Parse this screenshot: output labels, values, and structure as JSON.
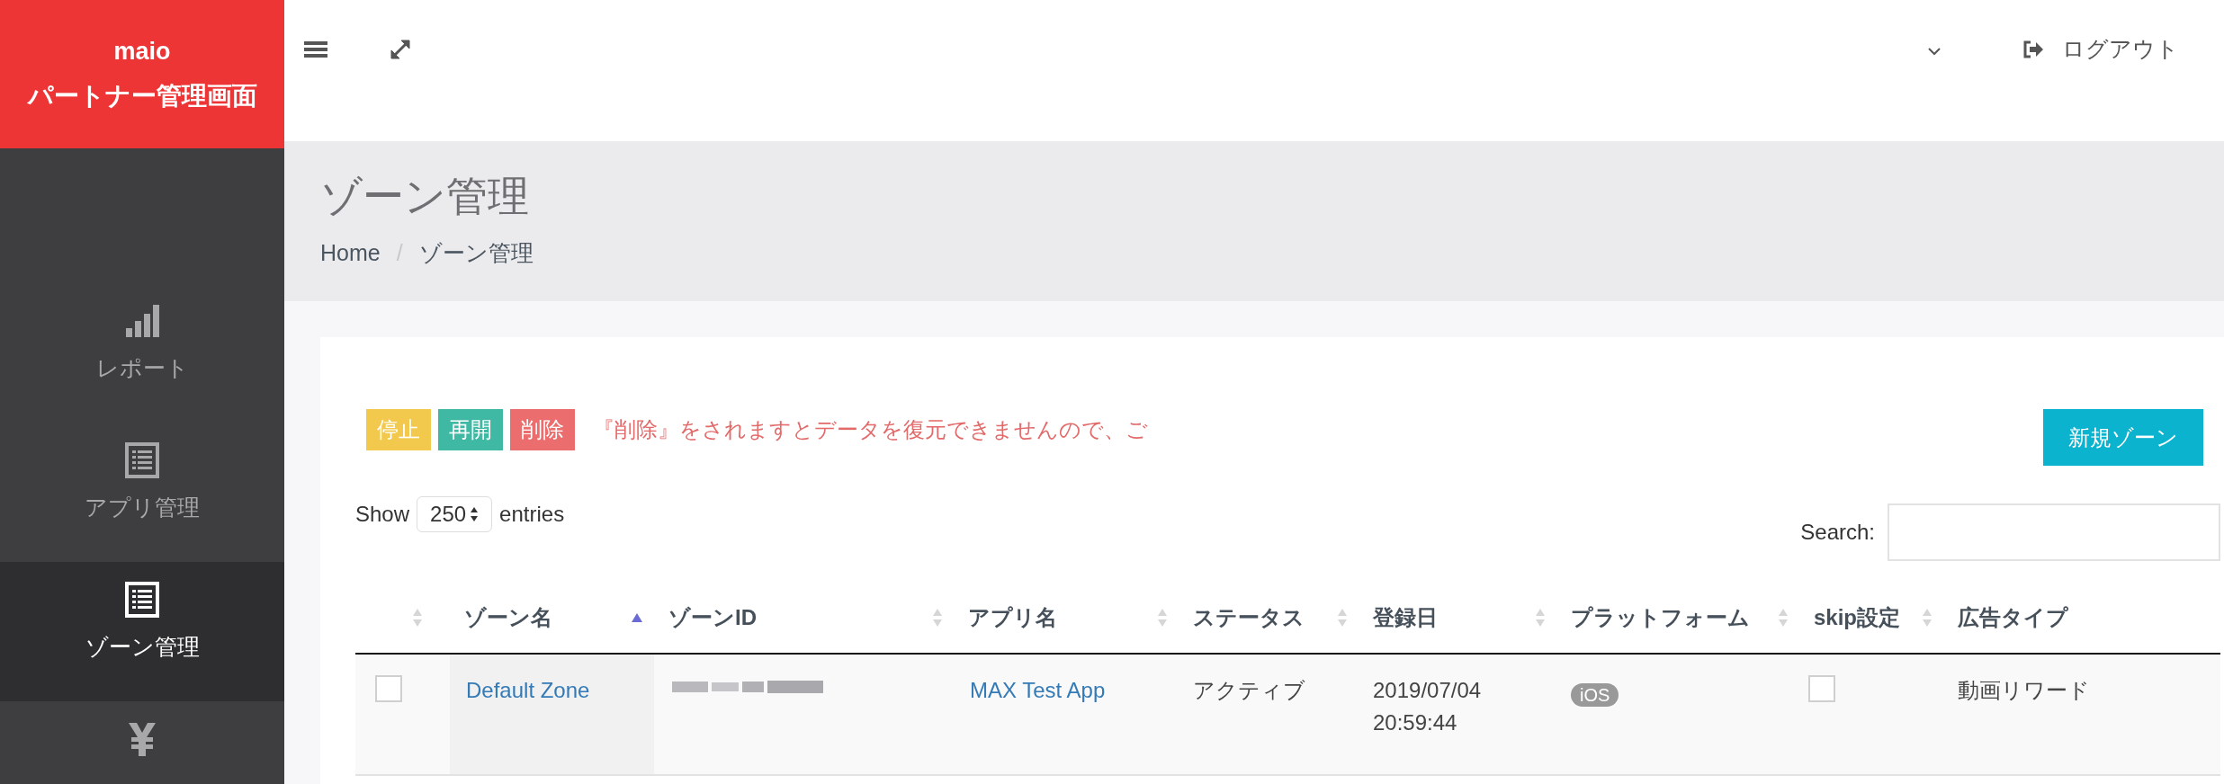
{
  "brand": {
    "name": "maio",
    "subtitle": "パートナー管理画面"
  },
  "sidebar": {
    "items": [
      {
        "label": "レポート",
        "selected": false
      },
      {
        "label": "アプリ管理",
        "selected": false
      },
      {
        "label": "ゾーン管理",
        "selected": true
      },
      {
        "selected": false
      }
    ]
  },
  "topbar": {
    "logout": "ログアウト"
  },
  "page": {
    "title": "ゾーン管理",
    "breadcrumb": [
      "Home",
      "ゾーン管理"
    ],
    "separator": "/"
  },
  "actions": [
    {
      "label": "停止",
      "color": "#f2c94c"
    },
    {
      "label": "再開",
      "color": "#3fb8a4"
    },
    {
      "label": "削除",
      "color": "#ec6d6d"
    }
  ],
  "warning": "『削除』をされますとデータを復元できませんので、ご",
  "new_button": "新規ゾーン",
  "length": {
    "show": "Show",
    "value": "250",
    "entries": "entries"
  },
  "search": {
    "label": "Search:"
  },
  "table": {
    "columns": [
      {
        "kind": "checkbox",
        "sortable": true,
        "sorted": false
      },
      {
        "label": "ゾーン名",
        "sortable": true,
        "sorted": true
      },
      {
        "label": "ゾーンID",
        "sortable": true,
        "sorted": false
      },
      {
        "label": "アプリ名",
        "sortable": true,
        "sorted": false
      },
      {
        "label": "ステータス",
        "sortable": true,
        "sorted": false
      },
      {
        "label": "登録日",
        "sortable": true,
        "sorted": false
      },
      {
        "label": "プラットフォーム",
        "sortable": true,
        "sorted": false
      },
      {
        "label": "skip設定",
        "sortable": true,
        "sorted": false
      },
      {
        "label": "広告タイプ",
        "sortable": false,
        "sorted": false
      }
    ],
    "rows": [
      {
        "checked": false,
        "zone_name": "Default Zone",
        "app_name": "MAX Test App",
        "status": "アクティブ",
        "registered": "2019/07/04 20:59:44",
        "platform": "iOS",
        "skip": false,
        "ad_type": "動画リワード"
      }
    ]
  }
}
